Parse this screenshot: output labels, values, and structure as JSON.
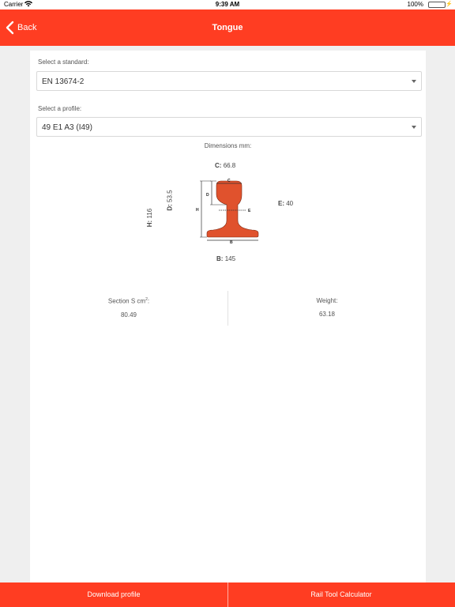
{
  "status_bar": {
    "carrier": "Carrier",
    "wifi_icon": "wifi-icon",
    "time": "9:39 AM",
    "battery_percent": "100%",
    "battery_level": 1.0,
    "battery_color": "#4cd964"
  },
  "nav": {
    "back_label": "Back",
    "title": "Tongue",
    "background": "#ff3d22"
  },
  "form": {
    "standard_label": "Select a standard:",
    "standard_value": "EN 13674-2",
    "profile_label": "Select a profile:",
    "profile_value": "49 E1 A3 (I49)"
  },
  "dimensions": {
    "title": "Dimensions mm:",
    "c": {
      "key": "C:",
      "value": "66.8"
    },
    "d": {
      "key": "D:",
      "value": "53.5"
    },
    "h": {
      "key": "H:",
      "value": "116"
    },
    "e": {
      "key": "E:",
      "value": "40"
    },
    "b": {
      "key": "B:",
      "value": "145"
    },
    "diagram_letters": {
      "c": "C",
      "d": "D",
      "h": "H",
      "e": "E",
      "b": "B"
    },
    "profile_color": "#e0522d"
  },
  "stats": {
    "section_label": "Section S cm",
    "section_sup": "2",
    "section_colon": ":",
    "section_value": "80.49",
    "weight_label": "Weight:",
    "weight_value": "63.18"
  },
  "bottom": {
    "download_label": "Download profile",
    "calculator_label": "Rail Tool Calculator"
  }
}
